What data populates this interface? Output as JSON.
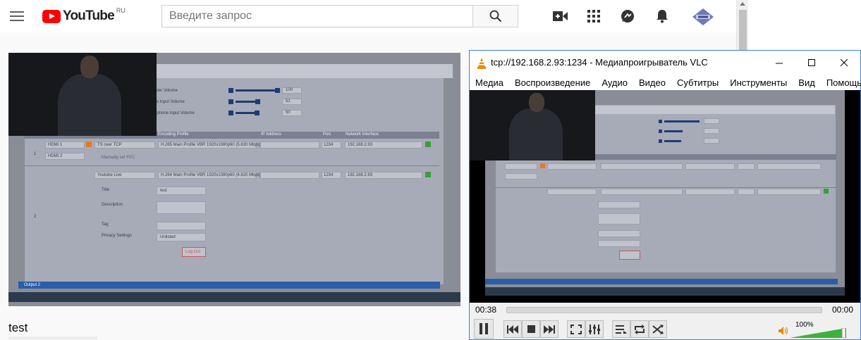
{
  "youtube": {
    "logo_text": "YouTube",
    "region": "RU",
    "search_placeholder": "Введите запрос"
  },
  "video": {
    "title": "test",
    "shot": {
      "volume_labels": [
        "aster Volume",
        "dio Input Volume",
        "rophone Input Volume"
      ],
      "volume_values": [
        "100",
        "51",
        "50"
      ],
      "table_headers": [
        "Encoding Profile",
        "IP Address",
        "Port",
        "Network Interface"
      ],
      "row1": {
        "num": "1",
        "input_a": "HDMI 1",
        "input_b": "HDMI 2",
        "protocol": "TS over TCP",
        "profile": "H.265 Main Profile VBR 1920x1080p60 (5.630 Mbps)",
        "port": "1234",
        "iface": "192.168.2.93",
        "note": "Manually set FEC"
      },
      "row2": {
        "num": "2",
        "protocol": "Youtube Live",
        "profile": "H.264 Main Profile VBR 1920x1080p60 (4.620 Mbps)",
        "port": "1234",
        "iface": "192.168.2.93"
      },
      "form_labels": [
        "Title",
        "Description",
        "Tag",
        "Privacy Settings"
      ],
      "form_title_value": "test",
      "privacy_value": "Unlisted",
      "login_button": "Log Out",
      "output_bar": "Output 2"
    }
  },
  "vlc": {
    "title": "tcp://192.168.2.93:1234 - Медиапроигрыватель VLC",
    "menu": [
      "Медиа",
      "Воспроизведение",
      "Аудио",
      "Видео",
      "Субтитры",
      "Инструменты",
      "Вид",
      "Помощь"
    ],
    "time_elapsed": "00:38",
    "time_total": "00:00",
    "volume_percent": "100%",
    "volume_level": 1.0
  }
}
